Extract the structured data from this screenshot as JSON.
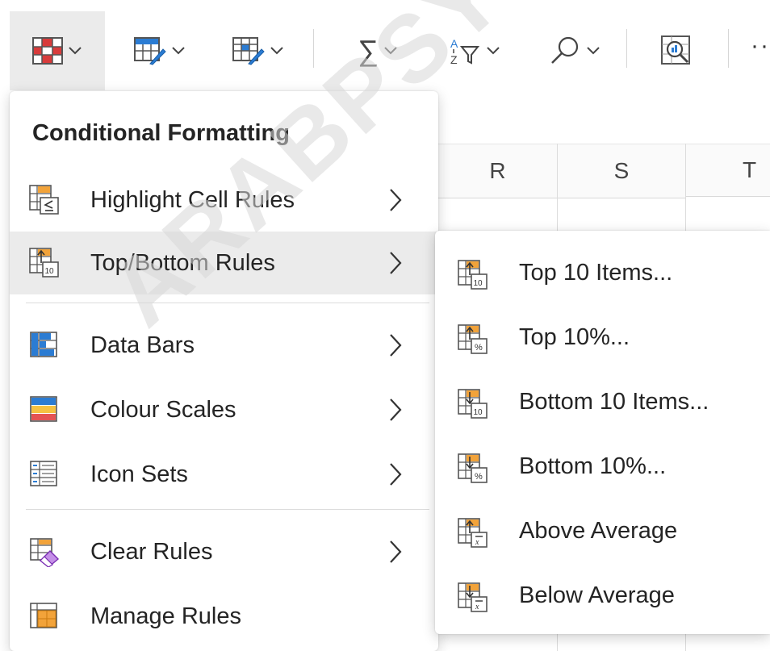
{
  "toolbar": {
    "buttons": [
      {
        "name": "conditional-formatting",
        "active": true
      },
      {
        "name": "format-as-table"
      },
      {
        "name": "cell-styles"
      },
      {
        "name": "autosum",
        "glyph": "∑"
      },
      {
        "name": "sort-filter"
      },
      {
        "name": "find-select"
      },
      {
        "name": "analyze-data"
      }
    ],
    "more": "··"
  },
  "grid": {
    "columns": [
      "R",
      "S",
      "T"
    ]
  },
  "menu": {
    "title": "Conditional Formatting",
    "items": [
      {
        "label": "Highlight Cell Rules",
        "icon": "highlight-cell-rules-icon",
        "submenu": true
      },
      {
        "label": "Top/Bottom Rules",
        "icon": "top-bottom-rules-icon",
        "submenu": true,
        "highlighted": true
      },
      {
        "label": "Data Bars",
        "icon": "data-bars-icon",
        "submenu": true
      },
      {
        "label": "Colour Scales",
        "icon": "colour-scales-icon",
        "submenu": true
      },
      {
        "label": "Icon Sets",
        "icon": "icon-sets-icon",
        "submenu": true
      },
      {
        "label": "Clear Rules",
        "icon": "clear-rules-icon",
        "submenu": true
      },
      {
        "label": "Manage Rules",
        "icon": "manage-rules-icon",
        "submenu": false
      }
    ]
  },
  "submenu": {
    "items": [
      {
        "label": "Top 10 Items...",
        "icon": "top-10-items-icon"
      },
      {
        "label": "Top 10%...",
        "icon": "top-10-percent-icon"
      },
      {
        "label": "Bottom 10 Items...",
        "icon": "bottom-10-items-icon"
      },
      {
        "label": "Bottom 10%...",
        "icon": "bottom-10-percent-icon"
      },
      {
        "label": "Above Average",
        "icon": "above-average-icon"
      },
      {
        "label": "Below Average",
        "icon": "below-average-icon"
      }
    ]
  },
  "watermark": "ARABPSYCHOLO",
  "colors": {
    "accent_orange": "#f2a33a",
    "accent_blue": "#2b7cd3",
    "accent_red": "#d83b3b",
    "highlight_bg": "#ebebeb",
    "purple": "#a24ad8"
  }
}
